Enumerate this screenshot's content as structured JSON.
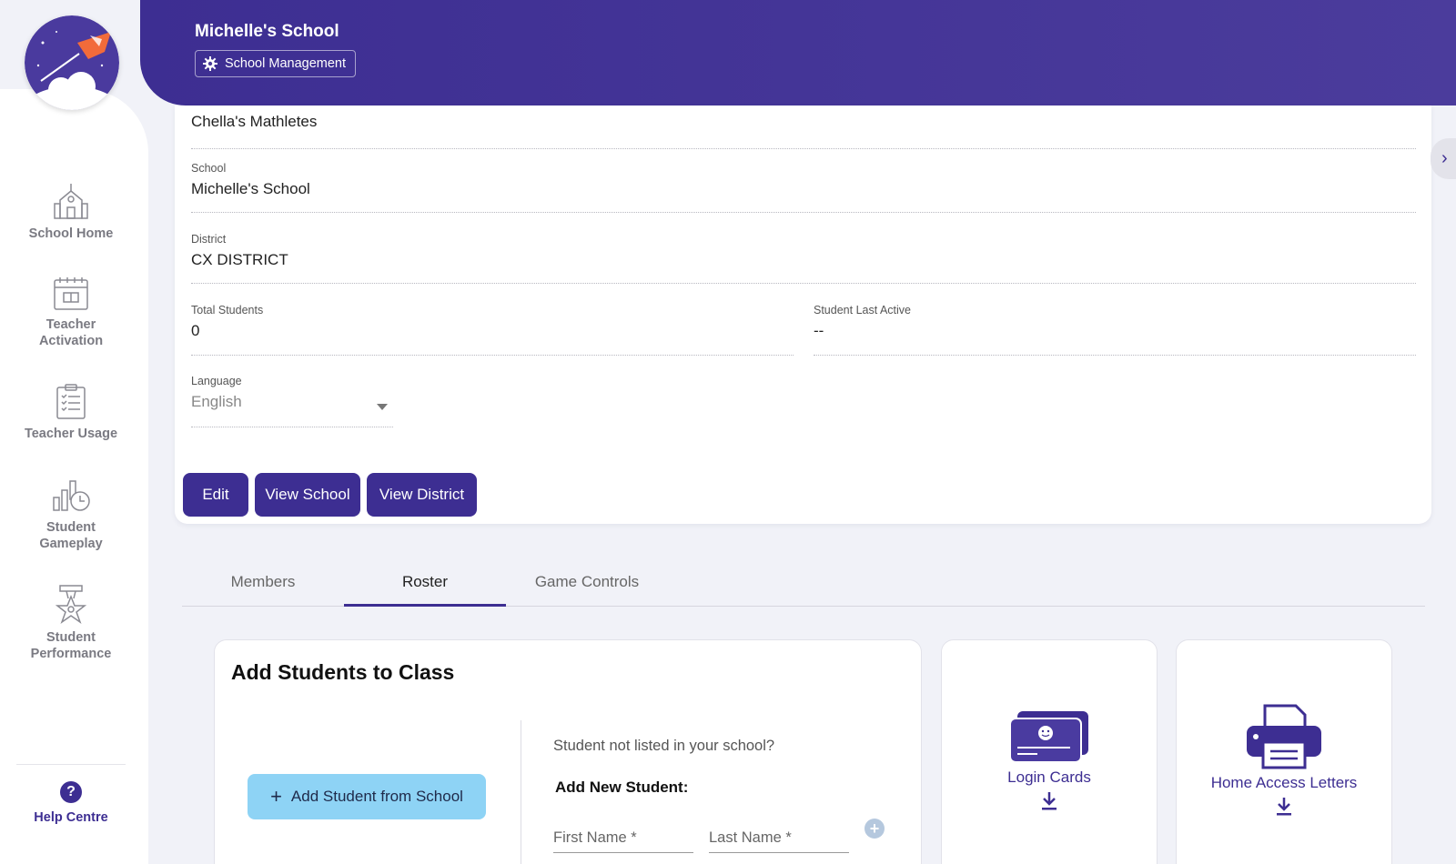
{
  "sidebar": {
    "items": [
      {
        "label": "School Home",
        "icon": "school-building-icon"
      },
      {
        "label": "Teacher\nActivation",
        "icon": "calendar-icon"
      },
      {
        "label": "Teacher Usage",
        "icon": "clipboard-checklist-icon"
      },
      {
        "label": "Student\nGameplay",
        "icon": "bar-chart-clock-icon"
      },
      {
        "label": "Student\nPerformance",
        "icon": "medal-star-icon"
      }
    ],
    "help_label": "Help Centre",
    "help_icon": "question-icon"
  },
  "header": {
    "school_name": "Michelle's School",
    "management_button": "School Management"
  },
  "details": {
    "class_name": "Chella's Mathletes",
    "school_label": "School",
    "school_value": "Michelle's School",
    "district_label": "District",
    "district_value": "CX DISTRICT",
    "total_students_label": "Total Students",
    "total_students_value": "0",
    "last_active_label": "Student Last Active",
    "last_active_value": "--",
    "language_label": "Language",
    "language_value": "English"
  },
  "buttons": {
    "edit": "Edit",
    "view_school": "View School",
    "view_district": "View District"
  },
  "tabs": [
    {
      "label": "Members",
      "active": false
    },
    {
      "label": "Roster",
      "active": true
    },
    {
      "label": "Game Controls",
      "active": false
    }
  ],
  "add_students": {
    "title": "Add Students to Class",
    "add_from_school": "Add Student from School",
    "not_listed": "Student not listed in your school?",
    "add_new": "Add New Student:",
    "first_name_placeholder": "First Name *",
    "last_name_placeholder": "Last Name *"
  },
  "downloads": {
    "login_cards": "Login Cards",
    "home_access_letters": "Home Access Letters"
  },
  "colors": {
    "brand_purple": "#3d2e92",
    "light_blue_button": "#8ed3f5",
    "background": "#f1f2f8"
  }
}
